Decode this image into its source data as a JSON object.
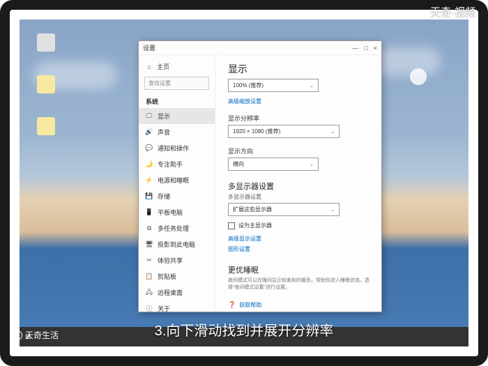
{
  "watermarks": {
    "top_right": "天奇·视频",
    "bottom_left": "天奇生活"
  },
  "caption": "3.向下滑动找到并展开分辨率",
  "window": {
    "title": "设置",
    "controls": {
      "min": "—",
      "max": "□",
      "close": "×"
    }
  },
  "sidebar": {
    "home": "主页",
    "search_placeholder": "查找设置",
    "category": "系统",
    "items": [
      {
        "icon": "🖵",
        "label": "显示",
        "active": true
      },
      {
        "icon": "🔊",
        "label": "声音"
      },
      {
        "icon": "💬",
        "label": "通知和操作"
      },
      {
        "icon": "🌙",
        "label": "专注助手"
      },
      {
        "icon": "⚡",
        "label": "电源和睡眠"
      },
      {
        "icon": "💾",
        "label": "存储"
      },
      {
        "icon": "📱",
        "label": "平板电脑"
      },
      {
        "icon": "⧉",
        "label": "多任务处理"
      },
      {
        "icon": "🖥",
        "label": "投影到此电脑"
      },
      {
        "icon": "✂",
        "label": "体验共享"
      },
      {
        "icon": "📋",
        "label": "剪贴板"
      },
      {
        "icon": "🖧",
        "label": "远程桌面"
      },
      {
        "icon": "ⓘ",
        "label": "关于"
      }
    ]
  },
  "content": {
    "heading": "显示",
    "scale": {
      "label": "100% (推荐)"
    },
    "advanced_scale_link": "高级缩放设置",
    "resolution_label": "显示分辨率",
    "resolution_value": "1920 × 1080 (推荐)",
    "orientation_label": "显示方向",
    "orientation_value": "横向",
    "multi_heading": "多显示器设置",
    "multi_label": "多显示器设置",
    "multi_value": "扩展这些显示器",
    "primary_checkbox": "设为主显示器",
    "advanced_display_link": "高级显示设置",
    "graphics_link": "图形设置",
    "better_heading": "更优睡眠",
    "better_text": "夜间模式可以在晚间显示较柔和的暖色，帮助你进入睡眠状态。选择\"夜间模式设置\"进行设置。",
    "help_link": "获取帮助"
  }
}
